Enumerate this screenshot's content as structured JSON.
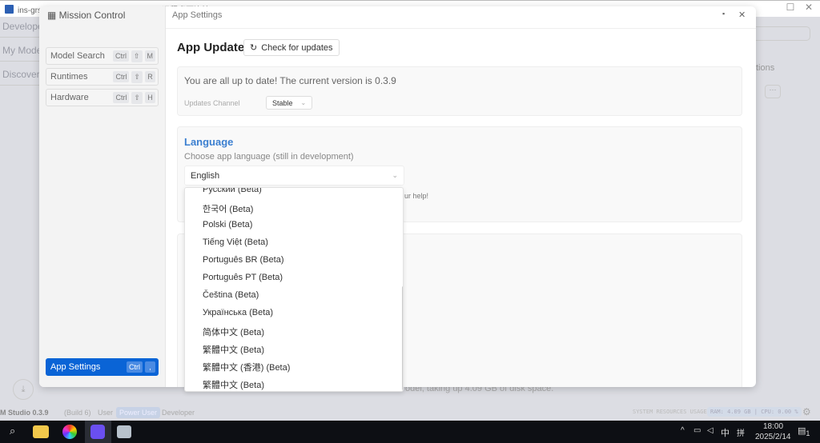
{
  "window": {
    "title": "ins-grsvsie7-43 - 43.155.155.103:3389 - 远程桌面连接"
  },
  "background": {
    "nav": [
      "Developer",
      "My Models",
      "Discover"
    ],
    "tab_partial": "tions",
    "info_text": "odel, taking up 4.09 GB of disk space.",
    "version": "M Studio 0.3.9",
    "build": "(Build 6)",
    "modes": [
      "User",
      "Power User",
      "Developer"
    ],
    "active_mode": "Power User",
    "resources_label": "SYSTEM RESOURCES USAGE:",
    "resources_value": "RAM: 4.09 GB | CPU: 0.00 %"
  },
  "modal": {
    "sidebar_title": "Mission Control",
    "header_title": "App Settings",
    "nav": [
      {
        "label": "Model Search",
        "keys": [
          "Ctrl",
          "⇧",
          "M"
        ]
      },
      {
        "label": "Runtimes",
        "keys": [
          "Ctrl",
          "⇧",
          "R"
        ]
      },
      {
        "label": "Hardware",
        "keys": [
          "Ctrl",
          "⇧",
          "H"
        ]
      }
    ],
    "active_nav": {
      "label": "App Settings",
      "keys": [
        "Ctrl",
        ","
      ]
    },
    "app_update": {
      "title": "App Update",
      "check_button": "Check for updates",
      "status": "You are all up to date! The current version is 0.3.9",
      "channel_label": "Updates Channel",
      "channel_value": "Stable"
    },
    "language": {
      "title": "Language",
      "subtitle": "Choose app language (still in development)",
      "selected": "English",
      "hint_partial": "ur help!",
      "options": [
        "Русский (Beta)",
        "한국어 (Beta)",
        "Polski (Beta)",
        "Tiếng Việt (Beta)",
        "Português BR (Beta)",
        "Português PT (Beta)",
        "Čeština (Beta)",
        "Українська (Beta)",
        "简体中文 (Beta)",
        "繁體中文 (Beta)",
        "繁體中文 (香港) (Beta)",
        "繁體中文 (Beta)"
      ]
    }
  },
  "taskbar": {
    "time": "18:00",
    "date": "2025/2/14",
    "ime": "中",
    "ime2": "拼",
    "notifications": "1"
  },
  "colors": {
    "accent": "#0a64d6",
    "heading_blue": "#3b7fd0"
  }
}
